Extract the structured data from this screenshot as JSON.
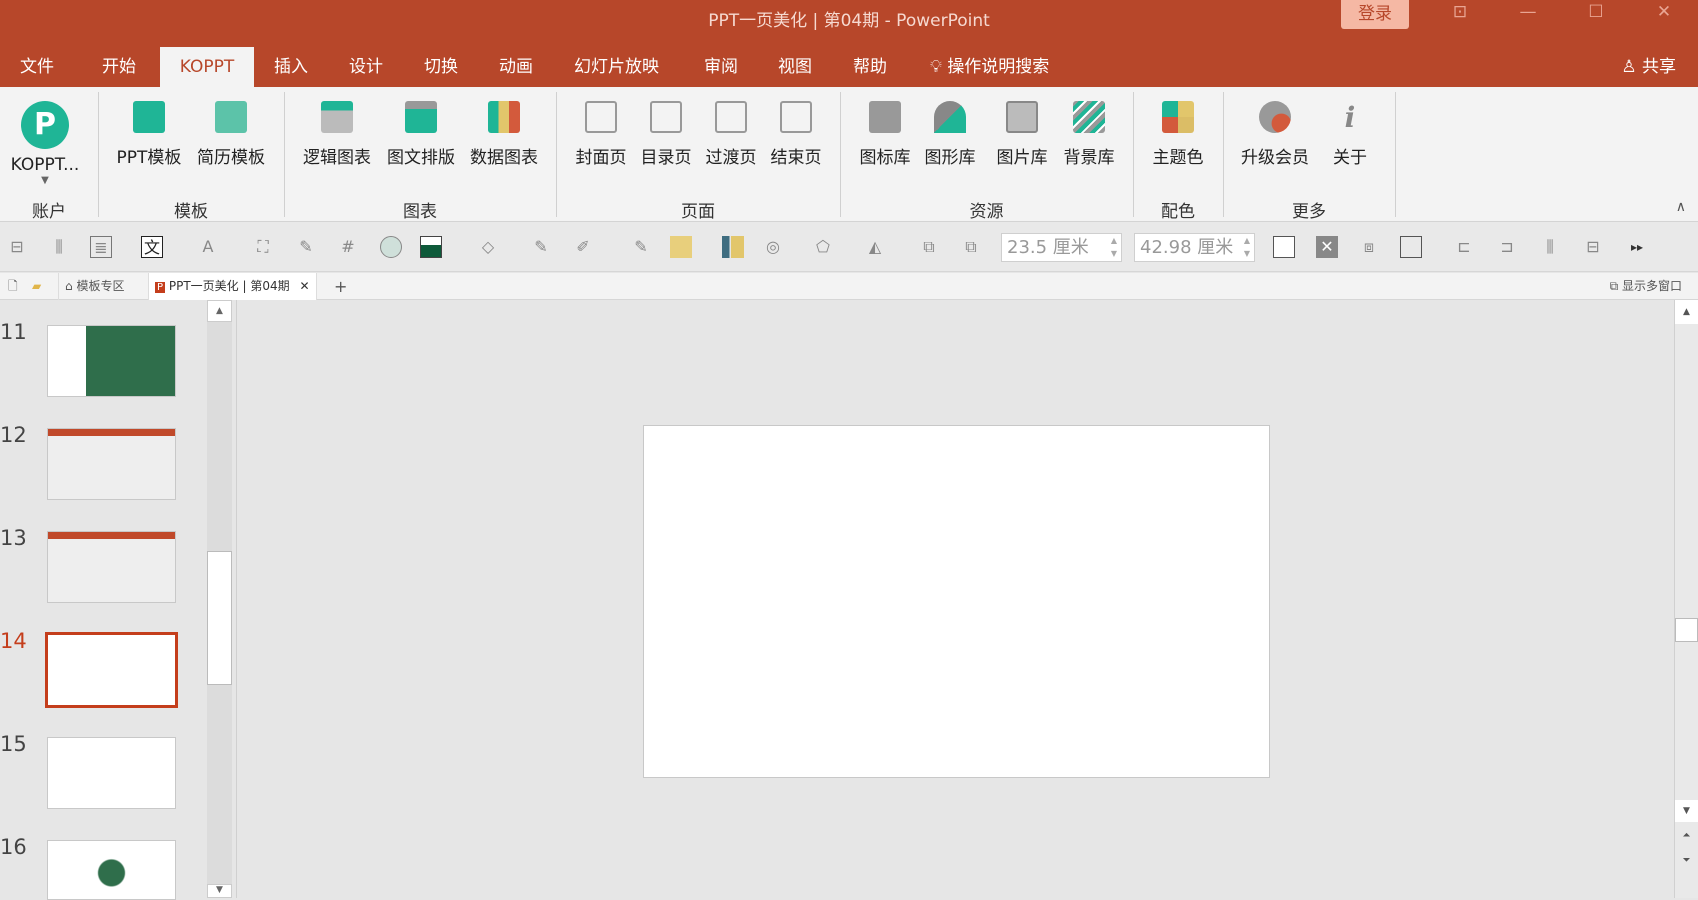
{
  "window": {
    "title": "PPT一页美化 | 第04期  -  PowerPoint",
    "login": "登录"
  },
  "tabs": [
    "文件",
    "开始",
    "KOPPT",
    "插入",
    "设计",
    "切换",
    "动画",
    "幻灯片放映",
    "审阅",
    "视图",
    "帮助"
  ],
  "search": "操作说明搜索",
  "share": "共享",
  "ribbon": {
    "account": {
      "label": "KOPPT...",
      "group": "账户"
    },
    "template": {
      "items": [
        "PPT模板",
        "简历模板"
      ],
      "group": "模板"
    },
    "chart": {
      "items": [
        "逻辑图表",
        "图文排版",
        "数据图表"
      ],
      "group": "图表"
    },
    "page": {
      "items": [
        "封面页",
        "目录页",
        "过渡页",
        "结束页"
      ],
      "group": "页面"
    },
    "resource": {
      "items": [
        "图标库",
        "图形库",
        "图片库",
        "背景库"
      ],
      "group": "资源"
    },
    "color": {
      "items": [
        "主题色"
      ],
      "group": "配色"
    },
    "more": {
      "items": [
        "升级会员",
        "关于"
      ],
      "group": "更多"
    }
  },
  "toolbar": {
    "height": "23.5 厘米",
    "width": "42.98 厘米"
  },
  "doctabs": {
    "home": "模板专区",
    "doc": "PPT一页美化 | 第04期",
    "multi": "显示多窗口"
  },
  "slides": [
    {
      "n": "11"
    },
    {
      "n": "12"
    },
    {
      "n": "13"
    },
    {
      "n": "14",
      "selected": true
    },
    {
      "n": "15"
    },
    {
      "n": "16"
    }
  ],
  "colors": {
    "accent": "#b7472a",
    "teal": "#1fb596"
  }
}
